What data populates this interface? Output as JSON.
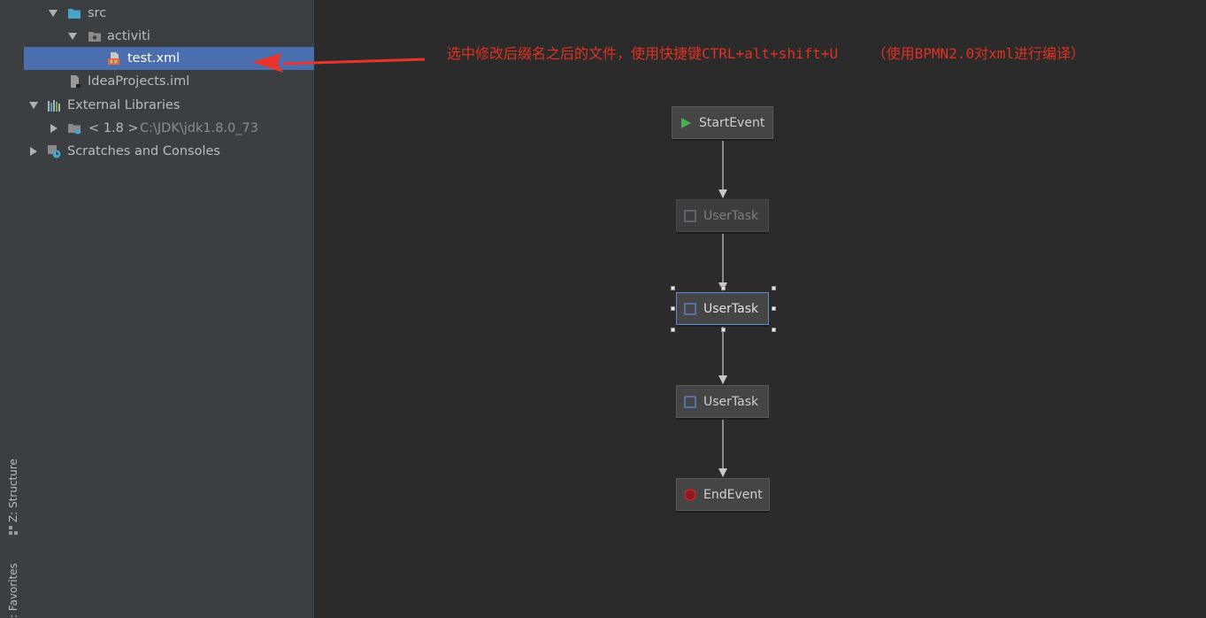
{
  "tool_windows": {
    "structure": "Z: Structure",
    "favorites": ": Favorites"
  },
  "project_tree": {
    "src": "src",
    "activiti": "activiti",
    "test_xml": "test.xml",
    "iml": "IdeaProjects.iml",
    "external_libraries": "External Libraries",
    "jdk_label": "< 1.8 >",
    "jdk_path": "C:\\JDK\\jdk1.8.0_73",
    "scratches": "Scratches and Consoles"
  },
  "annotation": {
    "text": "选中修改后缀名之后的文件，使用快捷键CTRL+alt+shift+U    （使用BPMN2.0对xml进行编译）",
    "color": "#e0321f"
  },
  "diagram": {
    "start": "StartEvent",
    "task1": "UserTask",
    "task2": "UserTask",
    "task3": "UserTask",
    "end": "EndEvent"
  },
  "colors": {
    "selection": "#4b6eaf",
    "panel": "#3c3f41",
    "canvas": "#2b2b2b",
    "start_icon": "#4caf50",
    "end_icon": "#c0262d",
    "task_icon": "#5b8bd4"
  },
  "icons": {
    "folder": "folder-icon",
    "package": "package-folder-icon",
    "xml": "xml-file-icon",
    "iml": "iml-file-icon",
    "libraries": "libraries-icon",
    "jdk": "jdk-icon",
    "scratches": "scratches-icon"
  }
}
